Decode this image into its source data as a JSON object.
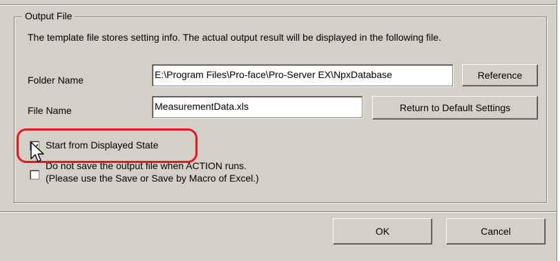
{
  "group": {
    "title": "Output File",
    "description": "The template file stores setting info. The actual output result will be displayed in the following file."
  },
  "folder": {
    "label": "Folder Name",
    "value": "E:\\Program Files\\Pro-face\\Pro-Server EX\\NpxDatabase",
    "button": "Reference"
  },
  "file": {
    "label": "File Name",
    "value": "MeasurementData.xls",
    "button": "Return to Default Settings"
  },
  "options": {
    "start_displayed": {
      "label": "Start from Displayed State",
      "checked": true
    },
    "no_save": {
      "line1": "Do not save the output file when ACTION runs.",
      "line2": "(Please use the Save or Save by Macro of Excel.)",
      "checked": false
    }
  },
  "footer": {
    "ok": "OK",
    "cancel": "Cancel"
  },
  "colors": {
    "highlight": "#e8141e",
    "face": "#d4d0c8"
  },
  "icons": {
    "cursor": "arrow-cursor-icon",
    "check": "checkmark-icon"
  }
}
